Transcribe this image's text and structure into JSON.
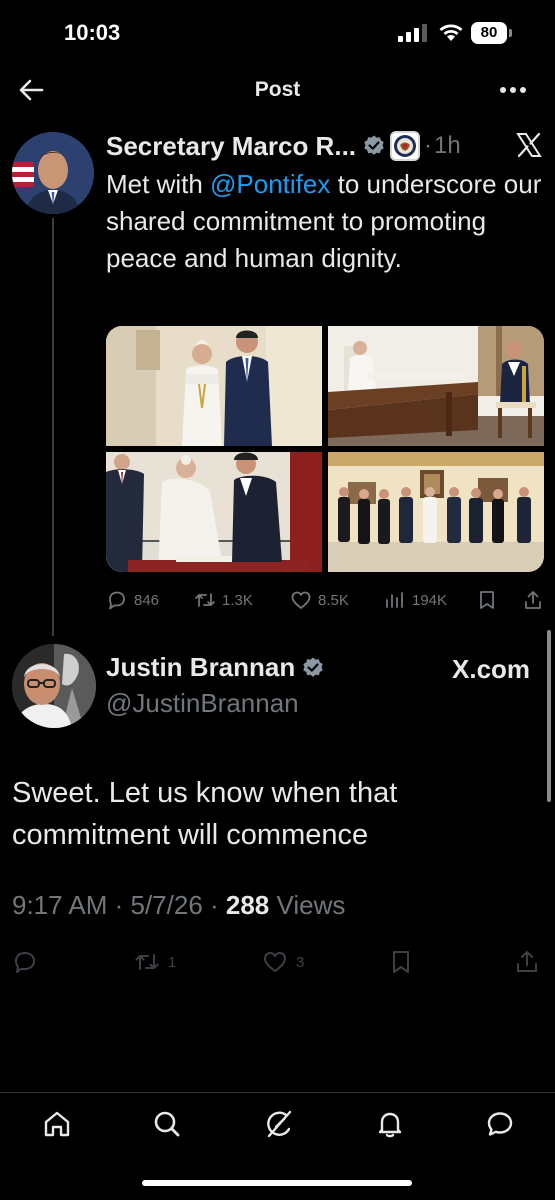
{
  "status_bar": {
    "time": "10:03",
    "battery": "80"
  },
  "header": {
    "title": "Post"
  },
  "tweet1": {
    "name": "Secretary Marco R",
    "ellipsis": "...",
    "separator": "·",
    "time": "1h",
    "text_before": "Met with ",
    "mention": "@Pontifex",
    "text_after": " to underscore our shared commitment to promoting peace and human dignity.",
    "stats": {
      "replies": "846",
      "reposts": "1.3K",
      "likes": "8.5K",
      "views": "194K"
    }
  },
  "tweet2": {
    "name": "Justin Brannan",
    "handle": "@JustinBrannan",
    "source_label": "X.com",
    "text": "Sweet. Let us know when that commitment will commence",
    "meta_time": "9:17 AM · 5/7/26 · ",
    "meta_views_count": "288",
    "meta_views_label": " Views",
    "stats": {
      "reposts": "1",
      "likes": "3"
    }
  },
  "icons": {
    "back": "back-arrow-icon",
    "more": "more-icon",
    "x_logo": "x-logo-icon",
    "verified": "verified-badge-icon",
    "seal": "state-department-seal-icon",
    "reply": "reply-icon",
    "repost": "repost-icon",
    "like": "like-icon",
    "views": "views-icon",
    "bookmark": "bookmark-icon",
    "share": "share-icon",
    "home": "home-icon",
    "search": "search-icon",
    "grok": "grok-icon",
    "notifications": "notifications-icon",
    "messages": "messages-icon"
  },
  "colors": {
    "background": "#000000",
    "text": "#e7e9ea",
    "secondary": "#71767b",
    "accent": "#1d9bf0",
    "verified": "#1d9bf0"
  }
}
